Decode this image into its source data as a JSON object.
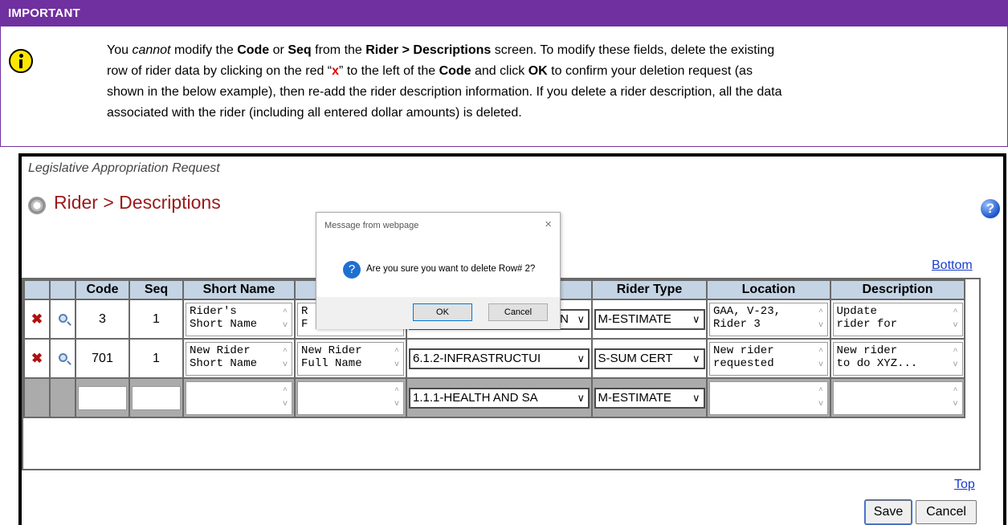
{
  "callout": {
    "header": "IMPORTANT",
    "line1_a": "You ",
    "line1_em": "cannot",
    "line1_b": " modify the ",
    "line1_code": "Code",
    "line1_c": " or ",
    "line1_seq": "Seq",
    "line1_d": " from the ",
    "line1_screen": "Rider > Descriptions",
    "line1_e": " screen. To modify these fields, delete the existing",
    "line2_a": "row of rider data by clicking on the red “",
    "line2_x": "x",
    "line2_b": "” to the left of the ",
    "line2_code": "Code",
    "line2_c": " and click ",
    "line2_ok": "OK",
    "line2_d": " to confirm your deletion request (as",
    "line3": "shown in the below example), then re-add the rider description information. If you delete a rider description, all the data",
    "line4": "associated with the rider (including all entered dollar amounts) is deleted."
  },
  "app": {
    "caption": "Legislative Appropriation Request",
    "title": "Rider > Descriptions",
    "help_glyph": "?",
    "bottom_link": "Bottom",
    "top_link": "Top"
  },
  "grid": {
    "headers": {
      "code": "Code",
      "seq": "Seq",
      "short_name": "Short Name",
      "rider_type": "Rider Type",
      "location": "Location",
      "description": "Description"
    },
    "rows": [
      {
        "code": "3",
        "seq": "1",
        "short_name": "Rider's\nShort Name",
        "full_name": "R\nF",
        "strategy": "MIN",
        "rider_type": "M-ESTIMATE",
        "location": "GAA, V-23,\nRider 3",
        "description": "Update\nrider for"
      },
      {
        "code": "701",
        "seq": "1",
        "short_name": "New Rider\nShort Name",
        "full_name": "New Rider\nFull Name",
        "strategy": "6.1.2-INFRASTRUCTUI",
        "rider_type": "S-SUM CERT",
        "location": "New rider\nrequested",
        "description": "New rider\nto do XYZ..."
      }
    ],
    "new_row": {
      "strategy": "1.1.1-HEALTH AND SA",
      "rider_type": "M-ESTIMATE"
    },
    "delete_glyph": "✖",
    "select_caret": "∨",
    "scroll_glyphs": "^\nv"
  },
  "dialog": {
    "title": "Message from webpage",
    "close": "×",
    "icon_glyph": "?",
    "message": "Are you sure you want to delete Row# 2?",
    "ok": "OK",
    "cancel": "Cancel"
  },
  "buttons": {
    "save": "Save",
    "cancel": "Cancel"
  },
  "colors": {
    "callout_purple": "#7030a0",
    "title_red": "#9a1a1a",
    "header_blue": "#c4d4e4",
    "link_blue": "#1a3ccc"
  }
}
